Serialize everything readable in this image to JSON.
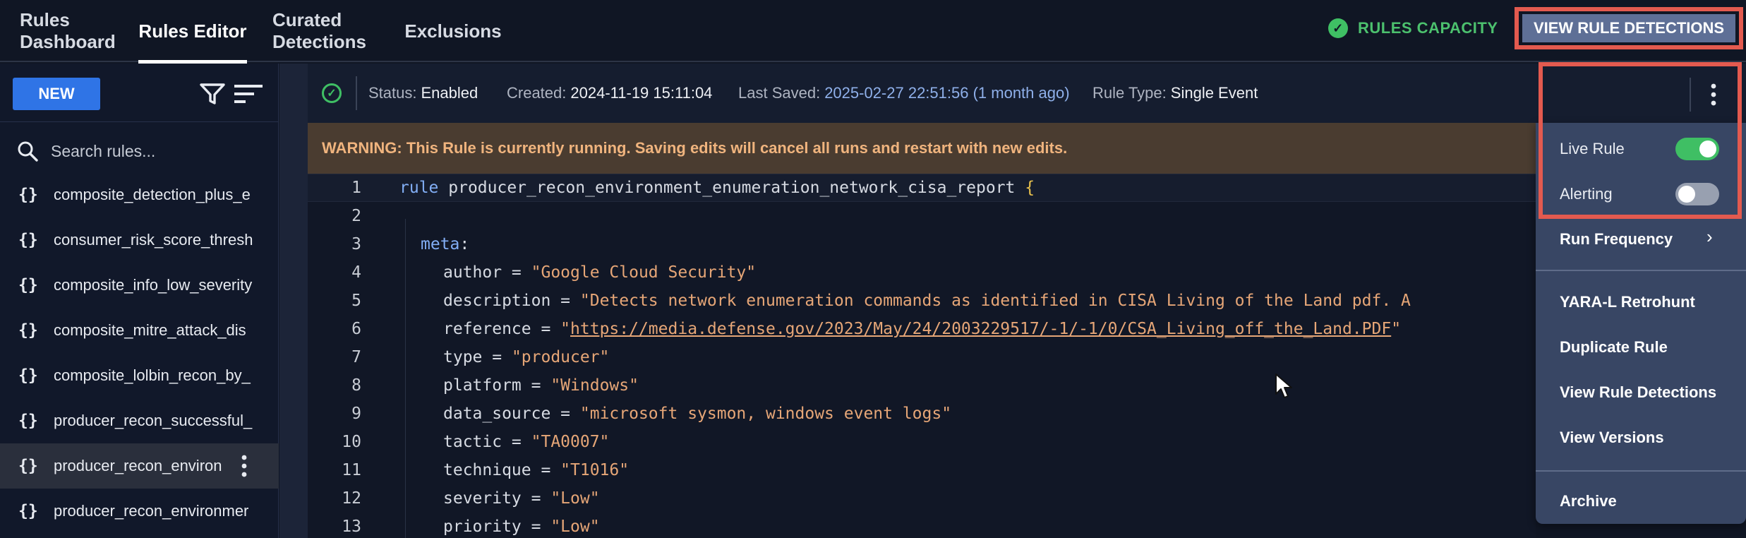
{
  "nav": {
    "tabs": [
      {
        "label": "Rules Dashboard"
      },
      {
        "label": "Rules Editor"
      },
      {
        "label": "Curated Detections"
      },
      {
        "label": "Exclusions"
      }
    ],
    "active_tab": "Rules Editor",
    "capacity_label": "RULES CAPACITY",
    "view_detections_label": "VIEW RULE DETECTIONS"
  },
  "sidebar": {
    "new_label": "NEW",
    "search_placeholder": "Search rules...",
    "rules": [
      {
        "name": "composite_detection_plus_e"
      },
      {
        "name": "consumer_risk_score_thresh"
      },
      {
        "name": "composite_info_low_severity"
      },
      {
        "name": "composite_mitre_attack_dis"
      },
      {
        "name": "composite_lolbin_recon_by_"
      },
      {
        "name": "producer_recon_successful_"
      },
      {
        "name": "producer_recon_environ"
      },
      {
        "name": "producer_recon_environmer"
      }
    ],
    "selected_index": 6
  },
  "status": {
    "status_label": "Status:",
    "status_value": "Enabled",
    "created_label": "Created:",
    "created_value": "2024-11-19 15:11:04",
    "saved_label": "Last Saved:",
    "saved_value": "2025-02-27 22:51:56 (1 month ago)",
    "type_label": "Rule Type:",
    "type_value": "Single Event"
  },
  "warning": "WARNING: This Rule is currently running. Saving edits will cancel all runs and restart with new edits.",
  "editor": {
    "line_numbers": [
      "1",
      "2",
      "3",
      "4",
      "5",
      "6",
      "7",
      "8",
      "9",
      "10",
      "11",
      "12",
      "13"
    ],
    "rule_keyword": "rule",
    "rule_name": "producer_recon_environment_enumeration_network_cisa_report",
    "open_brace": "{",
    "meta_keyword": "meta",
    "meta_colon": ":",
    "fields": [
      {
        "key": "author = ",
        "value": "\"Google Cloud Security\""
      },
      {
        "key": "description = ",
        "value": "\"Detects network enumeration commands as identified in CISA Living of the Land pdf. A"
      },
      {
        "key": "reference = ",
        "value": "https://media.defense.gov/2023/May/24/2003229517/-1/-1/0/CSA_Living_off_the_Land.PDF"
      },
      {
        "key": "type = ",
        "value": "\"producer\""
      },
      {
        "key": "platform = ",
        "value": "\"Windows\""
      },
      {
        "key": "data_source = ",
        "value": "\"microsoft sysmon, windows event logs\""
      },
      {
        "key": "tactic = ",
        "value": "\"TA0007\""
      },
      {
        "key": "technique = ",
        "value": "\"T1016\""
      },
      {
        "key": "severity = ",
        "value": "\"Low\""
      },
      {
        "key": "priority = ",
        "value": "\"Low\""
      }
    ],
    "quote": "\""
  },
  "menu": {
    "live_rule_label": "Live Rule",
    "live_rule_on": true,
    "alerting_label": "Alerting",
    "alerting_on": false,
    "run_frequency_label": "Run Frequency",
    "chevron": "›",
    "items": [
      {
        "label": "YARA-L Retrohunt"
      },
      {
        "label": "Duplicate Rule"
      },
      {
        "label": "View Rule Detections"
      },
      {
        "label": "View Versions"
      },
      {
        "label": "Archive"
      }
    ]
  },
  "icons": {
    "check": "✓"
  },
  "colors": {
    "background": "#101624",
    "accent_blue": "#2f74e6",
    "success_green": "#3fbf64",
    "highlight_red": "#e35a4f",
    "warning_bg": "#4a3c30",
    "warning_text": "#f0b47e",
    "menu_bg": "#384664",
    "string_orange": "#e6a677",
    "keyword_blue": "#82aef5"
  }
}
